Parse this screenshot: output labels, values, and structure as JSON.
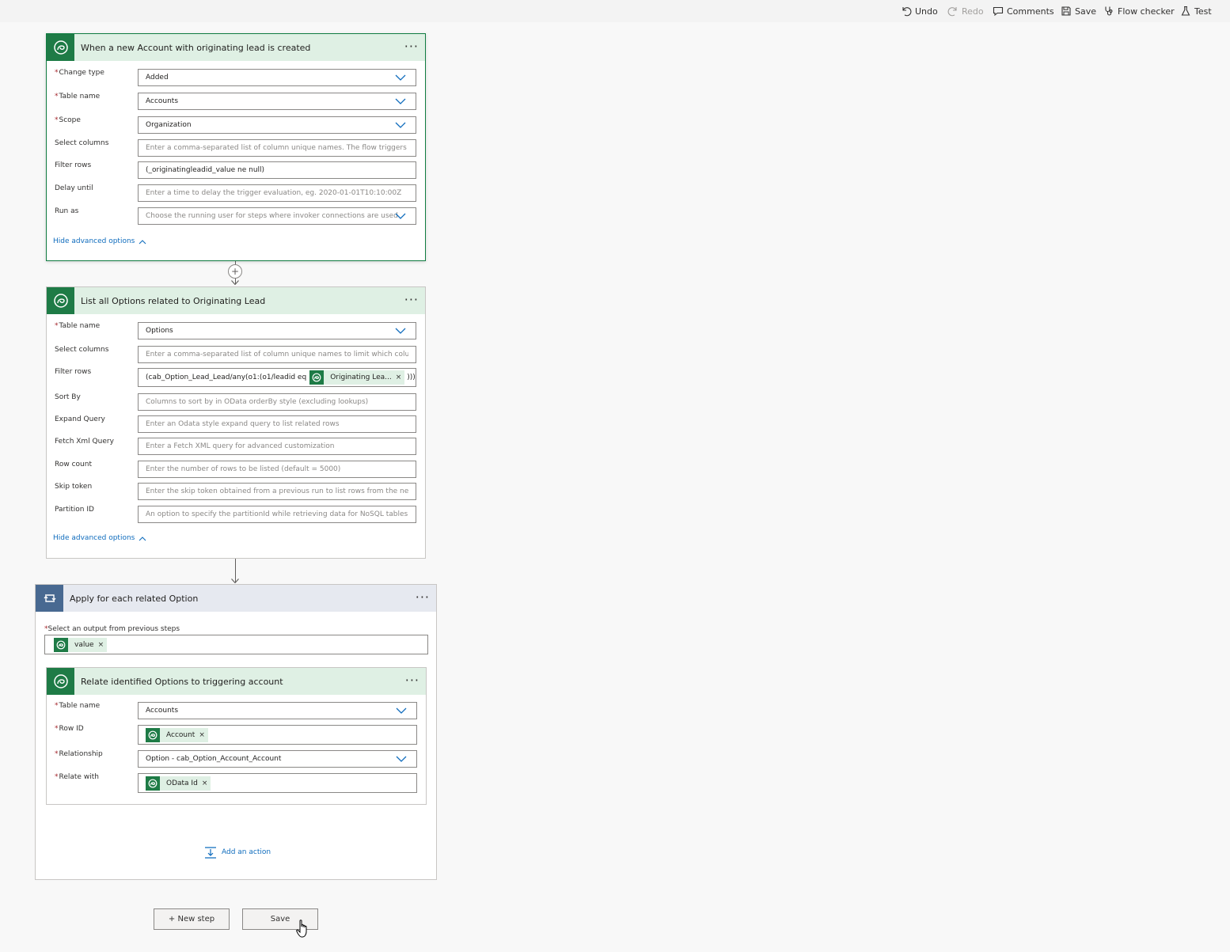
{
  "toolbar": {
    "undo": "Undo",
    "redo": "Redo",
    "comments": "Comments",
    "save": "Save",
    "flow_checker": "Flow checker",
    "test": "Test"
  },
  "trigger": {
    "title": "When a new Account with originating lead is created",
    "menu": "···",
    "change_type": {
      "label": "Change type",
      "value": "Added"
    },
    "table_name": {
      "label": "Table name",
      "value": "Accounts"
    },
    "scope": {
      "label": "Scope",
      "value": "Organization"
    },
    "select_columns": {
      "label": "Select columns",
      "placeholder": "Enter a comma-separated list of column unique names. The flow triggers if any"
    },
    "filter_rows": {
      "label": "Filter rows",
      "value": "(_originatingleadid_value ne null)"
    },
    "delay_until": {
      "label": "Delay until",
      "placeholder": "Enter a time to delay the trigger evaluation, eg. 2020-01-01T10:10:00Z"
    },
    "run_as": {
      "label": "Run as",
      "placeholder": "Choose the running user for steps where invoker connections are used"
    },
    "hide_advanced": "Hide advanced options"
  },
  "list_options": {
    "title": "List all Options related to Originating Lead",
    "menu": "···",
    "table_name": {
      "label": "Table name",
      "value": "Options"
    },
    "select_columns": {
      "label": "Select columns",
      "placeholder": "Enter a comma-separated list of column unique names to limit which columns a"
    },
    "filter_rows": {
      "label": "Filter rows",
      "prefix": "(cab_Option_Lead_Lead/any(o1:(o1/leadid eq",
      "token": "Originating Lea...",
      "suffix": ")))"
    },
    "sort_by": {
      "label": "Sort By",
      "placeholder": "Columns to sort by in OData orderBy style (excluding lookups)"
    },
    "expand_query": {
      "label": "Expand Query",
      "placeholder": "Enter an Odata style expand query to list related rows"
    },
    "fetch_xml": {
      "label": "Fetch Xml Query",
      "placeholder": "Enter a Fetch XML query for advanced customization"
    },
    "row_count": {
      "label": "Row count",
      "placeholder": "Enter the number of rows to be listed (default = 5000)"
    },
    "skip_token": {
      "label": "Skip token",
      "placeholder": "Enter the skip token obtained from a previous run to list rows from the next pa"
    },
    "partition_id": {
      "label": "Partition ID",
      "placeholder": "An option to specify the partitionId while retrieving data for NoSQL tables"
    },
    "hide_advanced": "Hide advanced options"
  },
  "apply_each": {
    "title": "Apply for each related Option",
    "menu": "···",
    "select_label": "Select an output from previous steps",
    "token": "value",
    "add_action": "Add an action"
  },
  "relate": {
    "title": "Relate identified Options to triggering account",
    "menu": "···",
    "table_name": {
      "label": "Table name",
      "value": "Accounts"
    },
    "row_id": {
      "label": "Row ID",
      "token": "Account"
    },
    "relationship": {
      "label": "Relationship",
      "value": "Option - cab_Option_Account_Account"
    },
    "relate_with": {
      "label": "Relate with",
      "token": "OData Id"
    }
  },
  "footer": {
    "new_step": "+ New step",
    "save": "Save"
  },
  "common": {
    "required": "*",
    "remove": "×",
    "plus": "+"
  },
  "colors": {
    "dataverse_green": "#1e7b46",
    "header_green": "#dff0e4",
    "loop_blue": "#486991",
    "link_blue": "#0f6cbd",
    "required_red": "#a4262c"
  }
}
